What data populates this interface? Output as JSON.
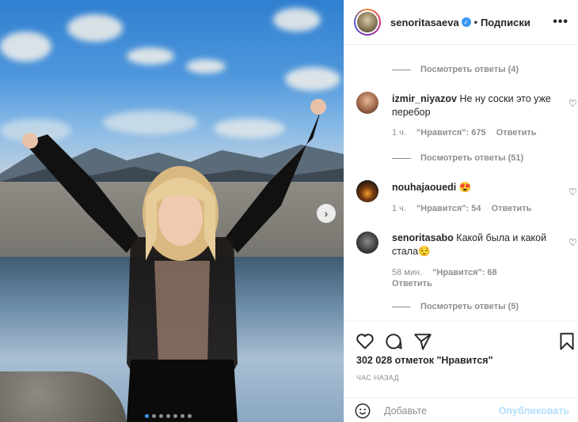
{
  "header": {
    "username": "senoritasaeva",
    "verified_icon": "verified-badge-icon",
    "separator": "•",
    "follow_label": "Подписки",
    "more_label": "•••"
  },
  "carousel": {
    "next_label": "›",
    "dot_count": 7,
    "active_dot": 0
  },
  "comments": {
    "view_replies_top": "Посмотреть ответы (4)",
    "items": [
      {
        "username": "izmir_niyazov",
        "text": "Не ну соски это уже перебор",
        "time": "1 ч.",
        "likes": "\"Нравится\": 675",
        "reply": "Ответить",
        "view_replies": "Посмотреть ответы (51)"
      },
      {
        "username": "nouhajaouedi",
        "text": "😍",
        "time": "1 ч.",
        "likes": "\"Нравится\": 54",
        "reply": "Ответить"
      },
      {
        "username": "senoritasabo",
        "text": "Какой была и какой стала😌",
        "time": "58 мин.",
        "likes": "\"Нравится\": 68",
        "reply": "Ответить",
        "view_replies": "Посмотреть ответы (5)"
      }
    ]
  },
  "actions": {
    "like_icon": "heart-icon",
    "comment_icon": "comment-icon",
    "share_icon": "share-icon",
    "save_icon": "bookmark-icon"
  },
  "likes_text": "302 028 отметок \"Нравится\"",
  "time_text": "ЧАС НАЗАД",
  "add_comment": {
    "placeholder": "Добавьте",
    "publish_label": "Опубликовать"
  },
  "colors": {
    "accent": "#3897f0",
    "publish_disabled": "#b2dffc",
    "muted": "#8e8e8e"
  }
}
